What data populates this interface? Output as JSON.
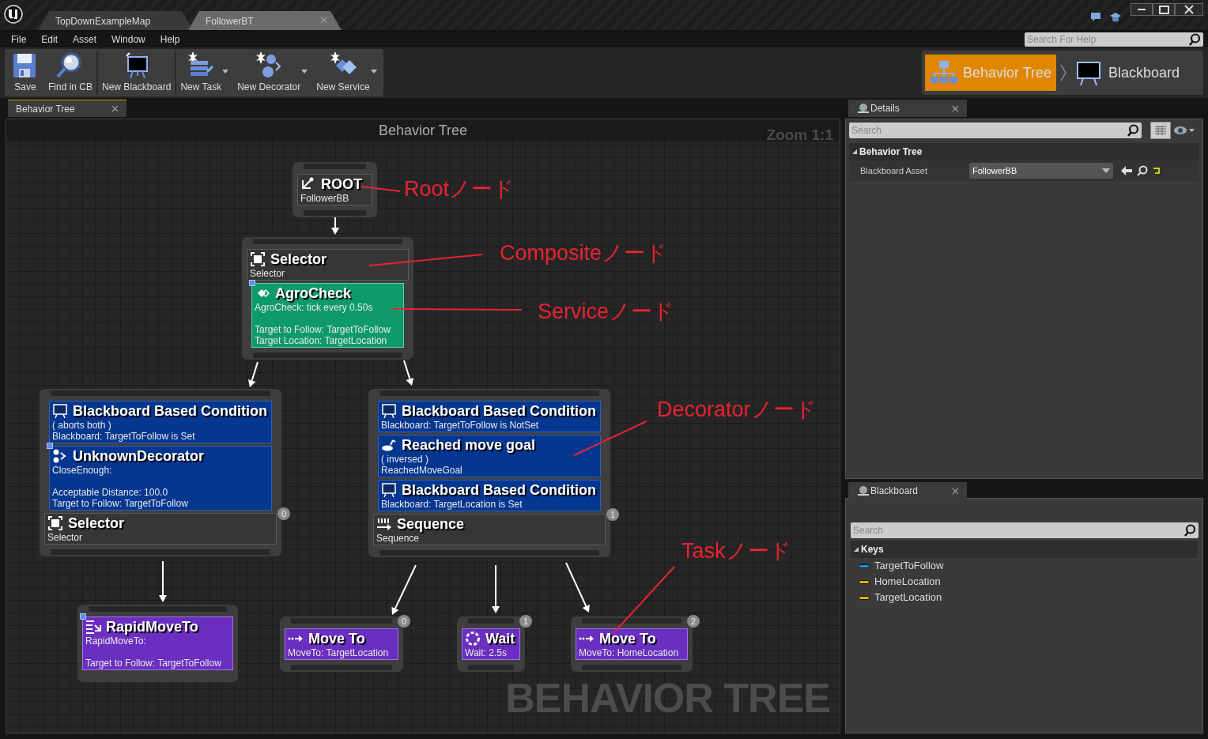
{
  "window": {
    "tabs": [
      {
        "label": "TopDownExampleMap",
        "selected": false,
        "closable": false
      },
      {
        "label": "FollowerBT",
        "selected": true,
        "closable": true
      }
    ]
  },
  "menu": [
    "File",
    "Edit",
    "Asset",
    "Window",
    "Help"
  ],
  "help_search": {
    "placeholder": "Search For Help"
  },
  "toolbar": [
    {
      "label": "Save",
      "kind": "save",
      "dropdown": false
    },
    {
      "label": "Find in CB",
      "kind": "find",
      "dropdown": false
    },
    {
      "label": "New Blackboard",
      "kind": "board",
      "dropdown": false
    },
    {
      "label": "New Task",
      "kind": "task",
      "dropdown": true
    },
    {
      "label": "New Decorator",
      "kind": "decorator",
      "dropdown": true
    },
    {
      "label": "New Service",
      "kind": "service",
      "dropdown": true
    }
  ],
  "modes": [
    {
      "label": "Behavior Tree",
      "kind": "tree",
      "selected": true
    },
    {
      "label": "Blackboard",
      "kind": "board",
      "selected": false
    }
  ],
  "graph": {
    "tab": "Behavior Tree",
    "title": "Behavior Tree",
    "zoom": "Zoom 1:1",
    "watermark": "BEHAVIOR TREE",
    "nodes": [
      {
        "blocks": [
          {
            "kind": "root",
            "title": "ROOT",
            "lines": [
              "FollowerBB"
            ],
            "marked": false
          }
        ]
      },
      {
        "blocks": [
          {
            "kind": "selector",
            "title": "Selector",
            "lines": [
              "Selector"
            ],
            "marked": false
          },
          {
            "kind": "service",
            "title": "AgroCheck",
            "lines": [
              "AgroCheck: tick every 0.50s"
            ],
            "details": [
              "Target to Follow: TargetToFollow",
              "Target Location: TargetLocation"
            ],
            "marked": true
          }
        ]
      },
      {
        "index": "0",
        "blocks": [
          {
            "kind": "blackboard",
            "title": "Blackboard Based Condition",
            "lines": [
              "( aborts both )",
              "Blackboard: TargetToFollow is Set"
            ],
            "marked": false
          },
          {
            "kind": "custom",
            "title": "UnknownDecorator",
            "lines": [
              "CloseEnough:"
            ],
            "details": [
              "Acceptable Distance: 100.0",
              "Target to Follow: TargetToFollow"
            ],
            "marked": true
          },
          {
            "kind": "selector",
            "title": "Selector",
            "lines": [
              "Selector"
            ],
            "marked": false
          }
        ]
      },
      {
        "index": "1",
        "blocks": [
          {
            "kind": "blackboard",
            "title": "Blackboard Based Condition",
            "lines": [
              "Blackboard: TargetToFollow is NotSet"
            ],
            "marked": false
          },
          {
            "kind": "reached",
            "title": "Reached move goal",
            "lines": [
              "( inversed )",
              "ReachedMoveGoal"
            ],
            "marked": false
          },
          {
            "kind": "blackboard",
            "title": "Blackboard Based Condition",
            "lines": [
              "Blackboard: TargetLocation is Set"
            ],
            "marked": false
          },
          {
            "kind": "sequence",
            "title": "Sequence",
            "lines": [
              "Sequence"
            ],
            "marked": false
          }
        ]
      },
      {
        "blocks": [
          {
            "kind": "rapid",
            "title": "RapidMoveTo",
            "lines": [
              "RapidMoveTo:"
            ],
            "details": [
              "Target to Follow: TargetToFollow"
            ],
            "marked": true
          }
        ]
      },
      {
        "index": "0",
        "blocks": [
          {
            "kind": "move",
            "title": "Move To",
            "lines": [
              "MoveTo: TargetLocation"
            ],
            "marked": false
          }
        ]
      },
      {
        "index": "1",
        "blocks": [
          {
            "kind": "wait",
            "title": "Wait",
            "lines": [
              "Wait: 2.5s"
            ],
            "marked": false
          }
        ]
      },
      {
        "index": "2",
        "blocks": [
          {
            "kind": "move",
            "title": "Move To",
            "lines": [
              "MoveTo: HomeLocation"
            ],
            "marked": false
          }
        ]
      }
    ],
    "annotations": [
      "Rootノード",
      "Compositeノード",
      "Serviceノード",
      "Decoratorノード",
      "Taskノード"
    ]
  },
  "details": {
    "tab": "Details",
    "search": {
      "placeholder": "Search"
    },
    "section": "Behavior Tree",
    "properties": [
      {
        "label": "Blackboard Asset",
        "value": "FollowerBB"
      }
    ]
  },
  "blackboard": {
    "tab": "Blackboard",
    "search": {
      "placeholder": "Search"
    },
    "section": "Keys",
    "keys": [
      {
        "name": "TargetToFollow",
        "color": "#1e8fe0"
      },
      {
        "name": "HomeLocation",
        "color": "#e0b000"
      },
      {
        "name": "TargetLocation",
        "color": "#e0b000"
      }
    ]
  }
}
